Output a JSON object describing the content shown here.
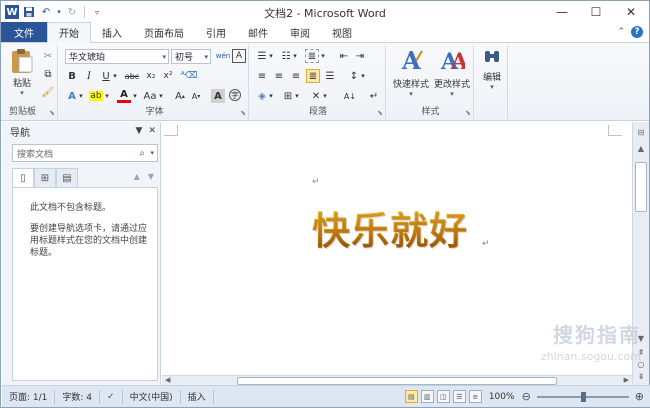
{
  "window": {
    "title": "文档2 - Microsoft Word",
    "app_icon": "W",
    "minimize": "—",
    "maximize": "☐",
    "close": "✕"
  },
  "tabs": {
    "file": "文件",
    "items": [
      "开始",
      "插入",
      "页面布局",
      "引用",
      "邮件",
      "审阅",
      "视图"
    ],
    "active": "开始"
  },
  "ribbon": {
    "clipboard": {
      "label": "剪贴板",
      "paste": "粘贴"
    },
    "font": {
      "label": "字体",
      "font_name": "华文琥珀",
      "font_size": "初号",
      "phonetic": "wén"
    },
    "paragraph": {
      "label": "段落"
    },
    "styles": {
      "label": "样式",
      "quick_styles": "快速样式",
      "change_styles": "更改样式"
    },
    "editing": {
      "label": "编辑"
    }
  },
  "nav": {
    "title": "导航",
    "search_placeholder": "搜索文档",
    "message1": "此文档不包含标题。",
    "message2": "要创建导航选项卡，请通过应用标题样式在您的文档中创建标题。"
  },
  "document": {
    "headline": "快乐就好",
    "para_mark": "↵"
  },
  "statusbar": {
    "page": "页面: 1/1",
    "words": "字数: 4",
    "language": "中文(中国)",
    "mode": "插入",
    "zoom": "100%",
    "zoom_level": 100
  },
  "watermark": {
    "cn": "搜狗指南",
    "url": "zhinan.sogou.com"
  },
  "colors": {
    "file_tab": "#2a5699",
    "headline_gold": "#d28813"
  }
}
